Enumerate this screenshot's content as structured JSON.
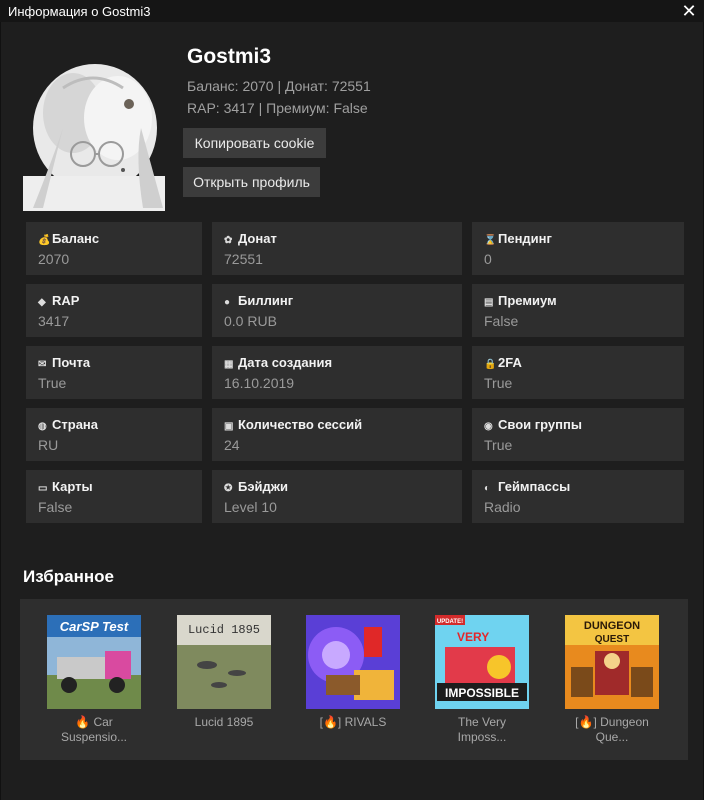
{
  "window": {
    "title": "Информация о Gostmi3",
    "close_glyph": "✕"
  },
  "profile": {
    "username": "Gostmi3",
    "line1": "Баланс: 2070 | Донат: 72551",
    "line2": "RAP: 3417 | Премиум: False",
    "copy_cookie_label": "Копировать cookie",
    "open_profile_label": "Открыть профиль"
  },
  "stats": [
    {
      "icon": "money-bag-icon",
      "glyph": "💰",
      "label": "Баланс",
      "value": "2070"
    },
    {
      "icon": "donate-icon",
      "glyph": "✿",
      "label": "Донат",
      "value": "72551"
    },
    {
      "icon": "hourglass-icon",
      "glyph": "⌛",
      "label": "Пендинг",
      "value": "0"
    },
    {
      "icon": "gem-icon",
      "glyph": "◆",
      "label": "RAP",
      "value": "3417"
    },
    {
      "icon": "billing-icon",
      "glyph": "●",
      "label": "Биллинг",
      "value": "0.0 RUB"
    },
    {
      "icon": "premium-icon",
      "glyph": "▤",
      "label": "Премиум",
      "value": "False"
    },
    {
      "icon": "mailbox-icon",
      "glyph": "✉",
      "label": "Почта",
      "value": "True"
    },
    {
      "icon": "calendar-icon",
      "glyph": "▦",
      "label": "Дата создания",
      "value": "16.10.2019"
    },
    {
      "icon": "lock-icon",
      "glyph": "🔒",
      "label": "2FA",
      "value": "True"
    },
    {
      "icon": "globe-icon",
      "glyph": "◍",
      "label": "Страна",
      "value": "RU"
    },
    {
      "icon": "sessions-icon",
      "glyph": "▣",
      "label": "Количество сессий",
      "value": "24"
    },
    {
      "icon": "groups-icon",
      "glyph": "◉",
      "label": "Свои группы",
      "value": "True"
    },
    {
      "icon": "card-icon",
      "glyph": "▭",
      "label": "Карты",
      "value": "False"
    },
    {
      "icon": "badge-icon",
      "glyph": "✪",
      "label": "Бэйджи",
      "value": "Level 10"
    },
    {
      "icon": "gamepad-icon",
      "glyph": "◐",
      "label": "Геймпассы",
      "value": "Radio"
    }
  ],
  "favorites": {
    "title": "Избранное",
    "games": [
      {
        "name_line1": "🔥 Car",
        "name_line2": "Suspensio...",
        "thumb_text": "CarSP Test"
      },
      {
        "name_line1": "Lucid 1895",
        "name_line2": "",
        "thumb_text": "Lucid 1895"
      },
      {
        "name_line1": "[🔥] RIVALS",
        "name_line2": "",
        "thumb_text": ""
      },
      {
        "name_line1": "The Very",
        "name_line2": "Imposs...",
        "thumb_text": "IMPOSSIBLE",
        "thumb_text2": "VERY",
        "thumb_badge": "UPDATE!"
      },
      {
        "name_line1": "[🔥] Dungeon",
        "name_line2": "Que...",
        "thumb_text": "DUNGEON",
        "thumb_text2": "QUEST"
      }
    ]
  }
}
